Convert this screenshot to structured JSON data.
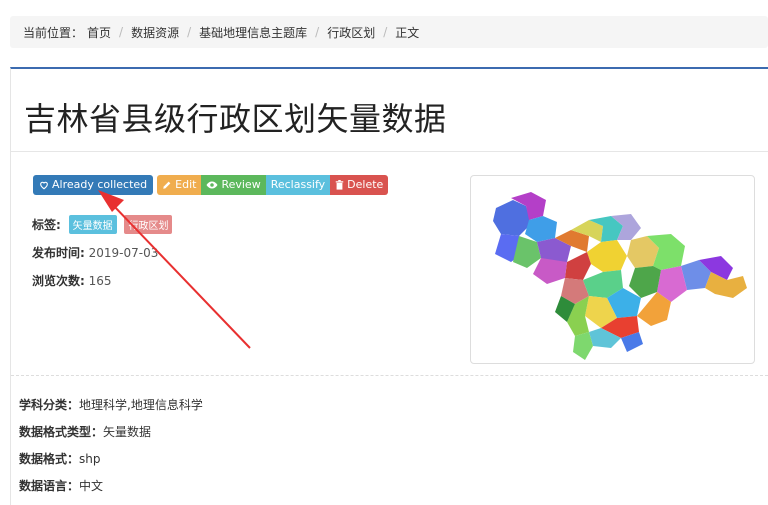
{
  "breadcrumb": {
    "prefix": "当前位置：",
    "items": [
      "首页",
      "数据资源",
      "基础地理信息主题库",
      "行政区划",
      "正文"
    ],
    "separator": "/"
  },
  "title": "吉林省县级行政区划矢量数据",
  "actions": {
    "collected": "Already collected",
    "edit": "Edit",
    "review": "Review",
    "reclassify": "Reclassify",
    "delete": "Delete"
  },
  "meta": {
    "tags_label": "标签:",
    "tags": [
      "矢量数据",
      "行政区划"
    ],
    "published_label": "发布时间:",
    "published_value": "2019-07-03",
    "views_label": "浏览次数:",
    "views_value": "165"
  },
  "details": {
    "subject_label": "学科分类：",
    "subject_value": "地理科学,地理信息科学",
    "format_type_label": "数据格式类型：",
    "format_type_value": "矢量数据",
    "format_label": "数据格式：",
    "format_value": "shp",
    "language_label": "数据语言：",
    "language_value": "中文"
  },
  "icons": {
    "collected": "heart-icon",
    "edit": "pencil-icon",
    "review": "eye-icon",
    "delete": "trash-icon"
  },
  "colors": {
    "accent": "#3c6bb0",
    "primary": "#337ab7",
    "warning": "#f0ad4e",
    "success": "#5cb85c",
    "info": "#5bc0de",
    "danger": "#d9534f",
    "annotation_arrow": "#e83030"
  }
}
